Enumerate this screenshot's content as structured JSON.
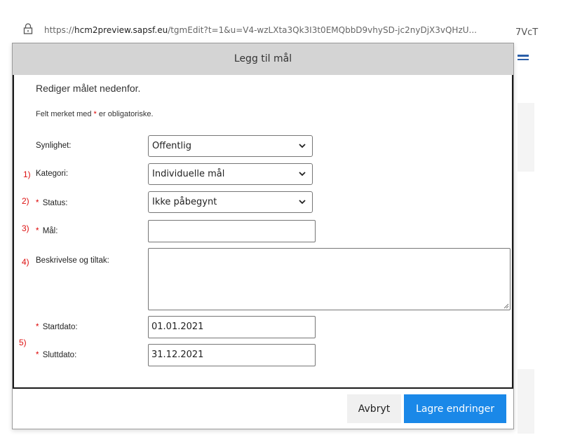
{
  "browser": {
    "url_prefix": "https://",
    "url_host": "hcm2preview.sapsf.eu",
    "url_path": "/tgmEdit?t=1&u=V4-wzLXta3Qk3I3t0EMQbbD9vhySD-jc2nyDjX3vQHzU...",
    "background_partial_text": "7VcT"
  },
  "dialog": {
    "title": "Legg til mål",
    "intro": "Rediger målet nedenfor.",
    "required_note_before": "Felt merket med ",
    "required_mark": "*",
    "required_note_after": " er obligatoriske."
  },
  "fields": {
    "visibility": {
      "label": "Synlighet:",
      "value": "Offentlig"
    },
    "category": {
      "label": "Kategori:",
      "value": "Individuelle mål",
      "annotation": "1)"
    },
    "status": {
      "label": "Status:",
      "value": "Ikke påbegynt",
      "annotation": "2)",
      "required": "*"
    },
    "goal": {
      "label": "Mål:",
      "value": "",
      "annotation": "3)",
      "required": "*"
    },
    "description": {
      "label": "Beskrivelse og tiltak:",
      "value": "",
      "annotation": "4)"
    },
    "start_date": {
      "label": "Startdato:",
      "value": "01.01.2021",
      "required": "*"
    },
    "end_date": {
      "label": "Sluttdato:",
      "value": "31.12.2021",
      "required": "*"
    },
    "dates_annotation": "5)"
  },
  "buttons": {
    "cancel": "Avbryt",
    "save": "Lagre endringer"
  },
  "colors": {
    "header_bg": "#d4d4d4",
    "save_bg": "#1a88e8",
    "required": "#dd0000",
    "annotation": "#dd1111"
  }
}
